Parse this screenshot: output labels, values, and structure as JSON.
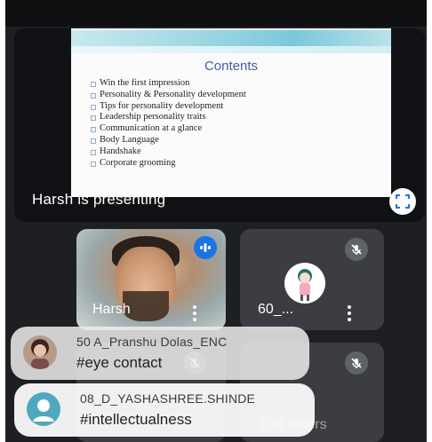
{
  "slide": {
    "title": "Contents",
    "bullets": [
      "Win the first impression",
      "Personality & Personality development",
      "Tips for personality development",
      "Leadership personality traits",
      "Communication at a glance",
      "Body Language",
      "Handshake",
      "Corporate grooming"
    ]
  },
  "presentation": {
    "status": "Harsh is presenting",
    "fullscreen_icon": "fullscreen-icon"
  },
  "tiles": [
    {
      "name": "Harsh",
      "icon": "speaking-indicator-icon",
      "accent": "#1a73e8"
    },
    {
      "name": "60_...",
      "icon": "mic-off-icon"
    },
    {
      "name": "",
      "icon": "mic-off-icon"
    },
    {
      "name": "189 others",
      "icon": "mic-off-icon"
    }
  ],
  "chat": [
    {
      "author": "50 A_Pranshu Dolas_ENC",
      "message": "#eye contact"
    },
    {
      "author": "08_D_YASHASHREE.SHINDE",
      "message": "#intellectualness",
      "avatar_color": "#4fa8bf"
    }
  ],
  "colors": {
    "background": "#1e1f23",
    "tile": "#3c3d42",
    "speaking": "#1a73e8"
  }
}
